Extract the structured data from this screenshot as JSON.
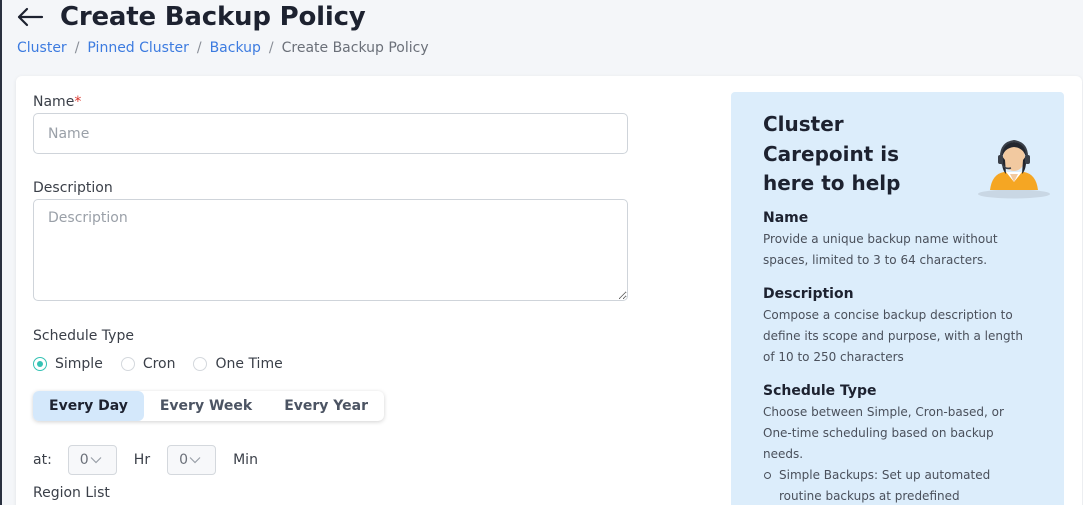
{
  "page": {
    "title": "Create Backup Policy"
  },
  "breadcrumb": {
    "items": [
      "Cluster",
      "Pinned Cluster",
      "Backup"
    ],
    "separator": "/",
    "current": "Create Backup Policy"
  },
  "form": {
    "name": {
      "label": "Name",
      "required_mark": "*",
      "placeholder": "Name",
      "value": ""
    },
    "description": {
      "label": "Description",
      "placeholder": "Description",
      "value": ""
    },
    "schedule_type": {
      "label": "Schedule Type",
      "options": [
        "Simple",
        "Cron",
        "One Time"
      ],
      "selected": "Simple"
    },
    "frequency": {
      "options": [
        "Every Day",
        "Every Week",
        "Every Year"
      ],
      "selected": "Every Day"
    },
    "time": {
      "at_label": "at:",
      "hour_value": "0",
      "hour_unit": "Hr",
      "minute_value": "0",
      "minute_unit": "Min"
    },
    "region_list": {
      "label": "Region List"
    }
  },
  "help": {
    "title": "Cluster Carepoint is here to help",
    "avatar_icon": "support-agent-icon",
    "sections": [
      {
        "heading": "Name",
        "text": "Provide a unique backup name without spaces, limited to 3 to 64 characters."
      },
      {
        "heading": "Description",
        "text": "Compose a concise backup description to define its scope and purpose, with a length of 10 to 250 characters"
      },
      {
        "heading": "Schedule Type",
        "text": "Choose between Simple, Cron-based, or One-time scheduling based on backup needs."
      }
    ],
    "bullets": [
      "Simple Backups: Set up automated routine backups at predefined intervals."
    ]
  },
  "colors": {
    "accent": "#35c2b4",
    "link": "#3c7be0",
    "help_bg": "#dcedfb",
    "segment_active": "#d4e8fb"
  }
}
